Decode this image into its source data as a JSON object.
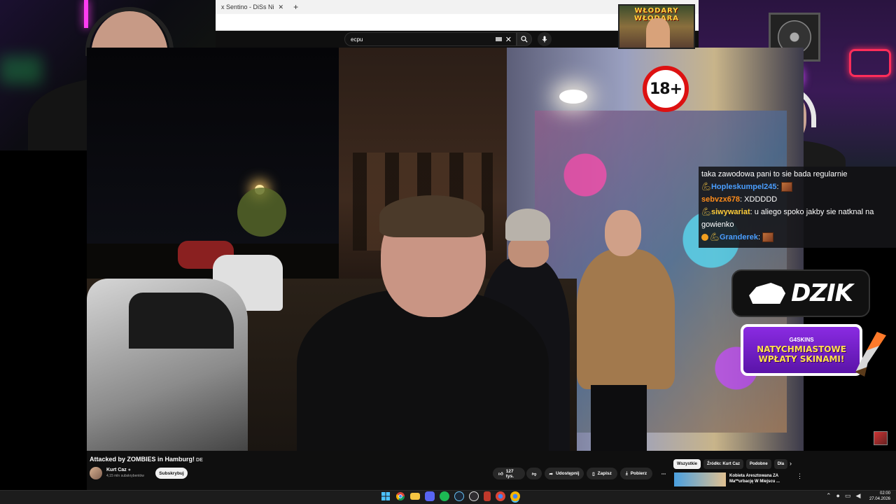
{
  "browser": {
    "tab_title": "x Sentino - DiSs Ni",
    "new_tab": "+"
  },
  "youtube": {
    "search": {
      "value": "ecpu"
    },
    "video": {
      "title": "Attacked by ZOMBIES in Hamburg!",
      "language_badge": "DE",
      "age_badge": "18+"
    },
    "channel": {
      "name": "Kurt Caz",
      "subscribers": "4,15 mln subskrybentów",
      "subscribe_label": "Subskrybuj"
    },
    "actions": {
      "likes": "127 tys.",
      "share": "Udostępnij",
      "save": "Zapisz",
      "download": "Pobierz"
    },
    "chips": [
      "Wszystkie",
      "Źródło: Kurt Caz",
      "Podobne",
      "Dla"
    ],
    "recommended": {
      "title": "Kobieta Aresztowana ZA Ma**urbację W Miejscu ..."
    }
  },
  "overlay": {
    "banner_title": "WŁODARY WŁODARA",
    "dzik_logo": "DZIK",
    "promo_brand": "G4SKINS",
    "promo_line1": "NATYCHMIASTOWE",
    "promo_line2": "WPŁATY SKINAMI!"
  },
  "chat": [
    {
      "user": "",
      "user_color": "#ffffff",
      "text": "taka zawodowa pani to sie bada regularnie"
    },
    {
      "user": "Hopleskumpel245",
      "user_color": "#4a9eff",
      "text": ""
    },
    {
      "user": "sebvzx678",
      "user_color": "#ff8c1a",
      "text": "XDDDDD"
    },
    {
      "user": "siwywariat",
      "user_color": "#ffcf3a",
      "text": "u aliego spoko jakby sie natknal na gowienko"
    },
    {
      "user": "Granderek",
      "user_color": "#4a9eff",
      "text": ""
    }
  ],
  "taskbar": {
    "time": "02:00",
    "date": "27.04.2026"
  },
  "colors": {
    "yt_bg": "#0f0f0f",
    "age_badge_ring": "#dd1111",
    "promo_purple": "#6a1cc4",
    "promo_text": "#ffe14d"
  }
}
